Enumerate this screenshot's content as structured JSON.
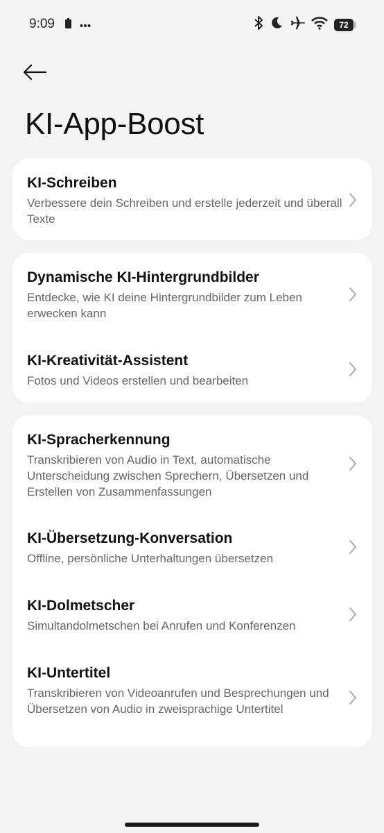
{
  "status_bar": {
    "time": "9:09",
    "left_icons": [
      "battery-saver-icon",
      "more-dots-icon"
    ],
    "right_icons": [
      "bluetooth-icon",
      "do-not-disturb-moon-icon",
      "airplane-mode-icon",
      "wifi-icon"
    ],
    "battery_level": "72"
  },
  "header": {
    "back_icon": "arrow-left-icon",
    "title": "KI-App-Boost"
  },
  "groups": [
    {
      "items": [
        {
          "title": "KI-Schreiben",
          "desc": "Verbessere dein Schreiben und erstelle jederzeit und überall Texte"
        }
      ]
    },
    {
      "items": [
        {
          "title": "Dynamische KI-Hintergrundbilder",
          "desc": "Entdecke, wie KI deine Hintergrundbilder zum Leben erwecken kann"
        },
        {
          "title": "KI-Kreativität-Assistent",
          "desc": "Fotos und Videos erstellen und bearbeiten"
        }
      ]
    },
    {
      "items": [
        {
          "title": "KI-Spracherkennung",
          "desc": "Transkribieren von Audio in Text, automatische Unterscheidung zwischen Sprechern, Übersetzen und Erstellen von Zusammenfassungen"
        },
        {
          "title": "KI-Übersetzung-Konversation",
          "desc": "Offline, persönliche Unterhaltungen übersetzen"
        },
        {
          "title": "KI-Dolmetscher",
          "desc": "Simultandolmetschen bei Anrufen und Konferenzen"
        },
        {
          "title": "KI-Untertitel",
          "desc": "Transkribieren von Videoanrufen und Besprechungen und Übersetzen von Audio in zweisprachige Untertitel"
        }
      ]
    }
  ]
}
